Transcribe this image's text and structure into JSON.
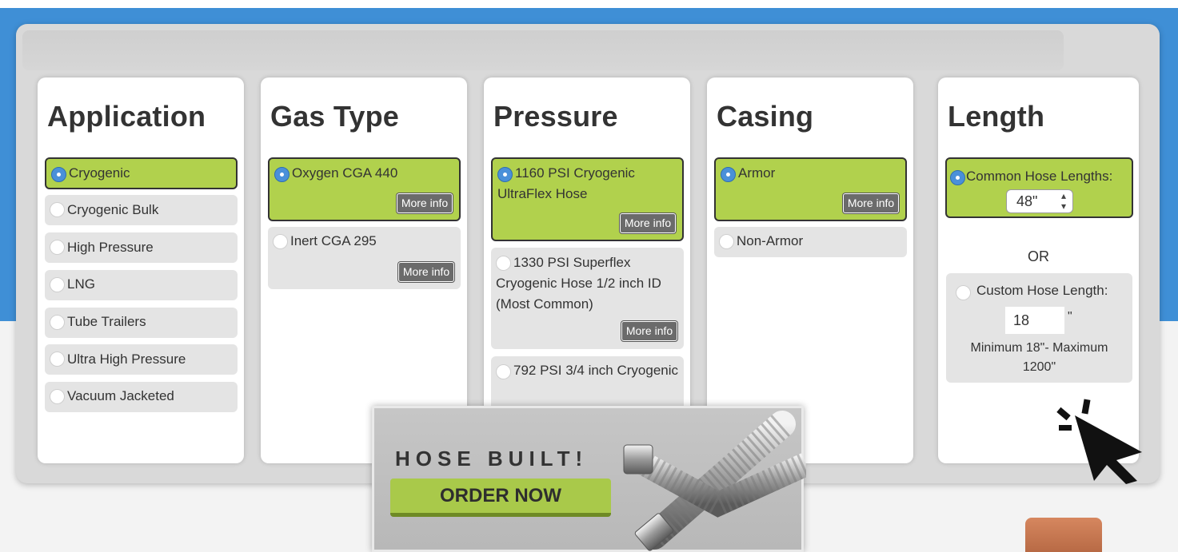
{
  "columns": [
    {
      "title": "Application",
      "options": [
        {
          "label": "Cryogenic",
          "selected": true
        },
        {
          "label": "Cryogenic Bulk",
          "selected": false
        },
        {
          "label": "High Pressure",
          "selected": false
        },
        {
          "label": "LNG",
          "selected": false
        },
        {
          "label": "Tube Trailers",
          "selected": false
        },
        {
          "label": "Ultra High Pressure",
          "selected": false
        },
        {
          "label": "Vacuum Jacketed",
          "selected": false
        }
      ]
    },
    {
      "title": "Gas Type",
      "options": [
        {
          "label": "Oxygen CGA 440",
          "selected": true,
          "more": "More info"
        },
        {
          "label": "Inert CGA 295",
          "selected": false,
          "more": "More info"
        }
      ]
    },
    {
      "title": "Pressure",
      "options": [
        {
          "label": "1160 PSI Cryogenic UltraFlex Hose",
          "selected": true,
          "more": "More info"
        },
        {
          "label": "1330 PSI Superflex Cryogenic Hose 1/2 inch ID (Most Common)",
          "selected": false,
          "more": "More info"
        },
        {
          "label": "792 PSI 3/4 inch Cryogenic",
          "selected": false
        }
      ]
    },
    {
      "title": "Casing",
      "options": [
        {
          "label": "Armor",
          "selected": true,
          "more": "More info"
        },
        {
          "label": "Non-Armor",
          "selected": false
        }
      ]
    },
    {
      "title": "Length",
      "common": {
        "label": "Common Hose Lengths:",
        "selected": true,
        "value": "48\""
      },
      "or_text": "OR",
      "custom": {
        "label": "Custom Hose Length:",
        "selected": false,
        "value": "18",
        "unit": "\"",
        "note": "Minimum 18\"- Maximum 1200\""
      }
    }
  ],
  "promo": {
    "title": "HOSE BUILT!",
    "button": "ORDER NOW"
  },
  "colors": {
    "blue": "#3f8fd6",
    "selected_green": "#b1d14d",
    "more_btn": "#6b6b6b",
    "radio_on": "#4a90d9"
  },
  "icons": {
    "cursor": "click-cursor-icon",
    "radio": "radio-icon",
    "spinner": "spinner-arrows-icon"
  }
}
